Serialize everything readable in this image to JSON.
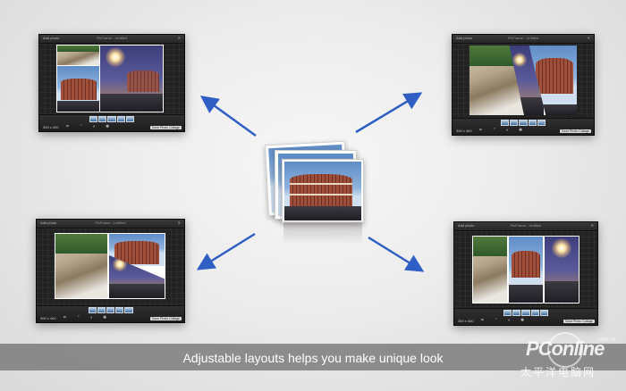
{
  "caption": "Adjustable layouts helps you make unique look",
  "watermark": {
    "brand": "PConline",
    "domain": ".com.cn",
    "chinese": "太平洋电脑网"
  },
  "windows": {
    "top_left": {
      "title": "PicFrame - Untitled",
      "open": "Add photo",
      "size": "300 x 400",
      "save": "Save Photo Collage"
    },
    "top_right": {
      "title": "PicFrame - Untitled",
      "open": "Add photo",
      "size": "300 x 400",
      "save": "Save Photo Collage"
    },
    "bottom_left": {
      "title": "PicFrame - Untitled",
      "open": "Add photo",
      "size": "300 x 400",
      "save": "Save Photo Collage"
    },
    "bottom_right": {
      "title": "PicFrame - Untitled",
      "open": "Add photo",
      "size": "300 x 400",
      "save": "Save Photo Collage"
    }
  },
  "colors": {
    "arrow": "#2f5fc4",
    "caption_bar": "#787878"
  },
  "icons": [
    "arrow-icon",
    "crop-icon",
    "adjust-icon",
    "settings-icon"
  ]
}
